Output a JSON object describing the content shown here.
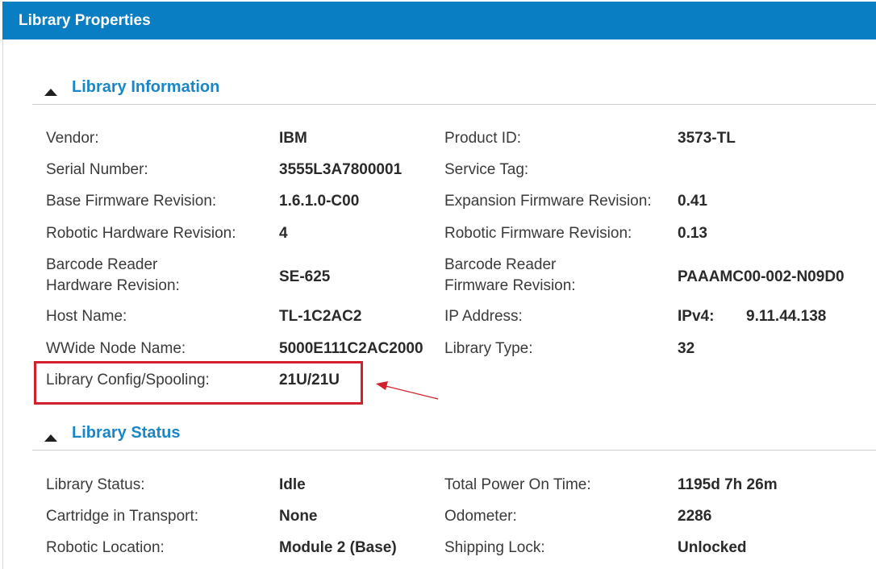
{
  "window": {
    "title": "Library Properties"
  },
  "sections": {
    "info": {
      "title": "Library Information",
      "vendor_label": "Vendor:",
      "vendor": "IBM",
      "product_id_label": "Product ID:",
      "product_id": "3573-TL",
      "serial_label": "Serial Number:",
      "serial": "3555L3A7800001",
      "service_tag_label": "Service Tag:",
      "service_tag": "",
      "base_fw_label": "Base Firmware Revision:",
      "base_fw": "1.6.1.0-C00",
      "exp_fw_label": "Expansion Firmware Revision:",
      "exp_fw": "0.41",
      "robotic_hw_label": "Robotic Hardware Revision:",
      "robotic_hw": "4",
      "robotic_fw_label": "Robotic Firmware Revision:",
      "robotic_fw": "0.13",
      "barcode_hw_label_1": "Barcode Reader",
      "barcode_hw_label_2": "Hardware Revision:",
      "barcode_hw": "SE-625",
      "barcode_fw_label_1": "Barcode Reader",
      "barcode_fw_label_2": "Firmware Revision:",
      "barcode_fw": "PAAAMC00-002-N09D0",
      "host_label": "Host Name:",
      "host": "TL-1C2AC2",
      "ip_label": "IP Address:",
      "ip_type": "IPv4:",
      "ip": "9.11.44.138",
      "wwnn_label": "WWide Node Name:",
      "wwnn": "5000E111C2AC2000",
      "lib_type_label": "Library Type:",
      "lib_type": "32",
      "config_label": "Library Config/Spooling:",
      "config": "21U/21U"
    },
    "status": {
      "title": "Library Status",
      "status_label": "Library Status:",
      "status": "Idle",
      "power_label": "Total Power On Time:",
      "power": "1195d 7h 26m",
      "cartridge_label": "Cartridge in Transport:",
      "cartridge": "None",
      "odometer_label": "Odometer:",
      "odometer": "2286",
      "location_label": "Robotic Location:",
      "location": "Module 2 (Base)",
      "lock_label": "Shipping Lock:",
      "lock": "Unlocked"
    }
  },
  "colors": {
    "header": "#0a7ec2",
    "section_title": "#1a86c6",
    "highlight": "#d21f2b"
  },
  "icons": {
    "collapse": "triangle-up-icon"
  }
}
